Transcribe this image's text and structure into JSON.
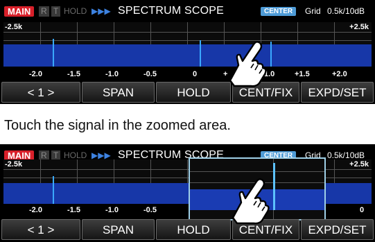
{
  "panel_top": {
    "main_tag": "MAIN",
    "r_tag": "R",
    "t_tag": "T",
    "hold_tag": "HOLD",
    "arrows": "▶▶▶",
    "title": "SPECTRUM SCOPE",
    "center_tag": "CENTER",
    "grid_text": "Grid",
    "span_text": "0.5k/10dB",
    "edge_left": "-2.5k",
    "edge_right": "+2.5k",
    "axis": [
      "-2.0",
      "-1.5",
      "-1.0",
      "-0.5",
      "0",
      "+",
      "1.0",
      "+1.5",
      "+2.0"
    ],
    "buttons": [
      "< 1 >",
      "SPAN",
      "HOLD",
      "CENT/FIX",
      "EXPD/SET"
    ]
  },
  "caption": "Touch the signal in the zoomed area.",
  "panel_bottom": {
    "main_tag": "MAIN",
    "r_tag": "R",
    "t_tag": "T",
    "hold_tag": "HOLD",
    "arrows": "▶▶▶",
    "title": "SPECTRUM SCOPE",
    "center_tag": "CENTER",
    "grid_text": "Grid",
    "span_text": "0.5k/10dB",
    "edge_left": "-2.5k",
    "edge_right": "+2.5k",
    "axis": [
      "-2.0",
      "-1.5",
      "-1.0",
      "-0.5",
      "0"
    ],
    "zoom_marker": "_◘",
    "buttons": [
      "< 1 >",
      "SPAN",
      "HOLD",
      "CENT/FIX",
      "EXPD/SET"
    ]
  },
  "colors": {
    "band_blue": "#1737a8",
    "peak_cyan": "#3aa9ff",
    "main_red": "#d8202a",
    "center_blue": "#4e9bd6",
    "zoom_border": "#9fd0e8"
  },
  "icons": [
    "touch-hand-icon"
  ]
}
